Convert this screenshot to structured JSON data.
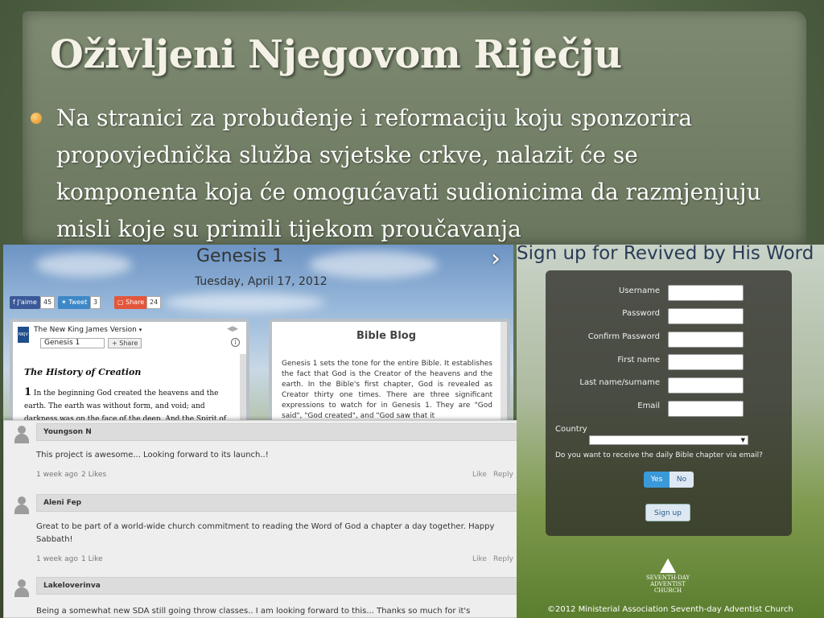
{
  "slide": {
    "title": "Oživljeni Njegovom Riječju",
    "bullet": "Na stranici za probuđenje i reformaciju koju sponzorira propovjednička služba svjetske crkve, nalazit će se komponenta koja će omogućavati sudionicima da razmjenjuju misli koje su primili tijekom proučavanja"
  },
  "bible_page": {
    "chapter_title": "Genesis 1",
    "date": "Tuesday, April 17, 2012",
    "social": {
      "like_label": "J'aime",
      "like_count": "45",
      "tweet_label": "Tweet",
      "tweet_count": "3",
      "share_label": "Share",
      "share_count": "24"
    },
    "version_label": "The New King James Version",
    "reference_value": "Genesis 1",
    "share_button": "+ Share",
    "section_heading": "The History of Creation",
    "verse_text": "In the beginning God created the heavens and the earth. The earth was without form, and void; and darkness was on the face of the deep. And the Spirit of God was hovering over",
    "blog_title": "Bible Blog",
    "blog_text": "Genesis 1 sets the tone for the entire Bible. It establishes the fact that God is the Creator of the heavens and the earth. In the Bible's first chapter, God is revealed as Creator thirty one times. There are three significant expressions to watch for in Genesis 1. They are \"God said\", \"God created\", and \"God saw that it"
  },
  "comments": [
    {
      "author": "Youngson N",
      "text": "This project is awesome... Looking forward to its launch..!",
      "time": "1 week ago",
      "likes": "2 Likes",
      "like": "Like",
      "reply": "Reply"
    },
    {
      "author": "Aleni Fep",
      "text": "Great to be part of a world-wide church commitment to reading the Word of God a chapter a day together.  Happy Sabbath!",
      "time": "1 week ago",
      "likes": "1 Like",
      "like": "Like",
      "reply": "Reply"
    },
    {
      "author": "Lakeloverinva",
      "text": "Being a somewhat new  SDA still going throw classes.. I am looking forward to this... Thanks so much for it's launch...."
    }
  ],
  "signup": {
    "title": "Sign up for Revived by His Word",
    "fields": [
      "Username",
      "Password",
      "Confirm Password",
      "First name",
      "Last name/surname",
      "Email"
    ],
    "country_label": "Country",
    "email_question": "Do you want to receive the daily Bible chapter via email?",
    "yes": "Yes",
    "no": "No",
    "submit": "Sign up",
    "logo_text": "SEVENTH-DAY ADVENTIST CHURCH",
    "copyright": "©2012 Ministerial Association  Seventh-day Adventist  Church"
  },
  "colors": {
    "accent_blue": "#3a9ad9",
    "title_text": "#f4f1e6",
    "bullet_orange": "#e08a1e"
  }
}
